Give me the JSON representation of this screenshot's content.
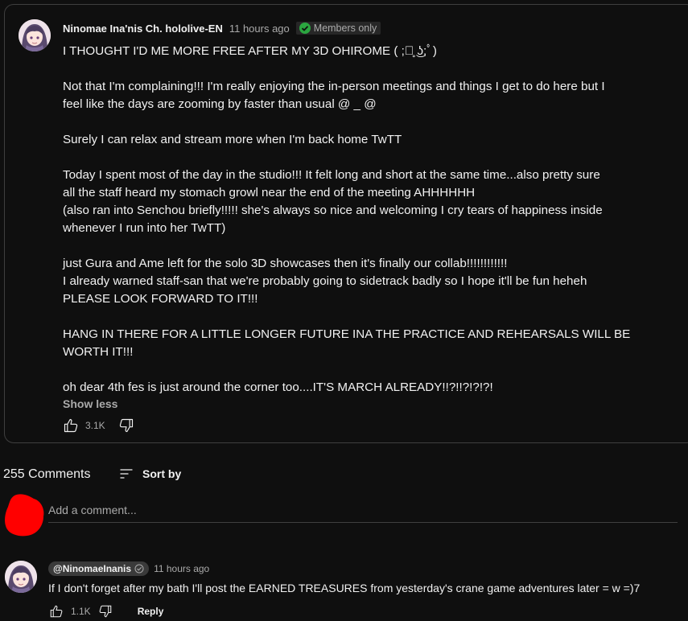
{
  "post": {
    "author": "Ninomae Ina'nis Ch. hololive-EN",
    "time": "11 hours ago",
    "members_badge": "Members only",
    "paragraphs": [
      {
        "lines": [
          "I THOUGHT I'D ME MORE FREE AFTER MY 3D OHIROME ( ;ﾟ̥ ͜ʖ;ﾟ)"
        ]
      },
      {
        "lines": [
          "Not that I'm complaining!!! I'm really enjoying the in-person meetings and things I get to do here but I",
          "feel like the days are zooming by faster than usual @ _ @"
        ]
      },
      {
        "lines": [
          "Surely I can relax and stream more when I'm back home TwTT"
        ]
      },
      {
        "lines": [
          "Today I spent most of the day in the studio!!! It felt long and short at the same time...also pretty sure",
          "all the staff heard my stomach growl near the end of the meeting AHHHHHH",
          "(also ran into Senchou briefly!!!!! she's always so nice and welcoming I cry tears of happiness inside",
          "whenever I run into her TwTT)"
        ]
      },
      {
        "lines": [
          "just Gura and Ame left for the solo 3D showcases then it's finally our collab!!!!!!!!!!!!",
          "I already warned staff-san that we're probably going to sidetrack badly so I hope it'll be fun heheh",
          "PLEASE LOOK FORWARD TO IT!!!"
        ]
      },
      {
        "lines": [
          "HANG IN THERE FOR A LITTLE LONGER FUTURE INA THE PRACTICE AND REHEARSALS WILL BE",
          "WORTH IT!!!"
        ]
      },
      {
        "lines": [
          "oh dear 4th fes is just around the corner too....IT'S MARCH ALREADY!!?!!?!?!?!"
        ]
      }
    ],
    "show_less": "Show less",
    "like_count": "3.1K",
    "icons": [
      "like-icon",
      "dislike-icon",
      "members-check-icon"
    ]
  },
  "comments": {
    "count_label": "255 Comments",
    "sort_label": "Sort by",
    "add_placeholder": "Add a comment..."
  },
  "reply": {
    "handle": "@NinomaeInanis",
    "time": "11 hours ago",
    "text": "If I don't forget after my bath I'll post the EARNED TREASURES from yesterday's crane game adventures later = w =)7",
    "like_count": "1.1K",
    "reply_label": "Reply"
  },
  "colors": {
    "background": "#0f0f0f",
    "card_border": "#3f3f3f",
    "text_primary": "#f1f1f1",
    "text_secondary": "#aaaaaa",
    "members_check": "#2ba640",
    "redaction": "#ff0000"
  }
}
